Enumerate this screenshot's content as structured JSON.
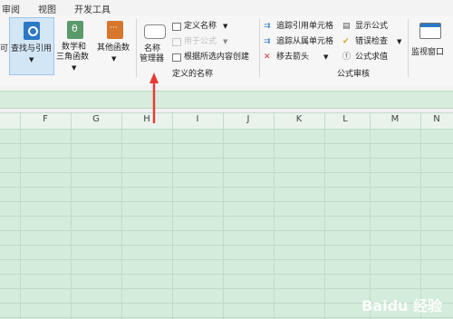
{
  "tabs": [
    "审阅",
    "视图",
    "开发工具"
  ],
  "ribbon": {
    "left_cut_label": "可",
    "lookup": {
      "label": "查找与引用",
      "has_dropdown": true
    },
    "math": {
      "line1": "数学和",
      "line2": "三角函数",
      "has_dropdown": true
    },
    "other": {
      "label": "其他函数",
      "has_dropdown": true
    },
    "name_manager": {
      "line1": "名称",
      "line2": "管理器"
    },
    "define_name": "定义名称",
    "use_in_formula": "用于公式",
    "create_from_selection": "根据所选内容创建",
    "group_defined_names": "定义的名称",
    "trace_precedents": "追踪引用单元格",
    "trace_dependents": "追踪从属单元格",
    "remove_arrows": "移去箭头",
    "show_formulas": "显示公式",
    "error_checking": "错误检查",
    "evaluate_formula": "公式求值",
    "group_formula_auditing": "公式审核",
    "watch_window": "监视窗口"
  },
  "columns": [
    "F",
    "G",
    "H",
    "I",
    "J",
    "K",
    "L",
    "M",
    "N"
  ],
  "watermark": "Baidu 经验",
  "colors": {
    "accent_blue": "#2b78c5",
    "arrow_red": "#e83a35",
    "grid_green": "#d4ecdb"
  }
}
